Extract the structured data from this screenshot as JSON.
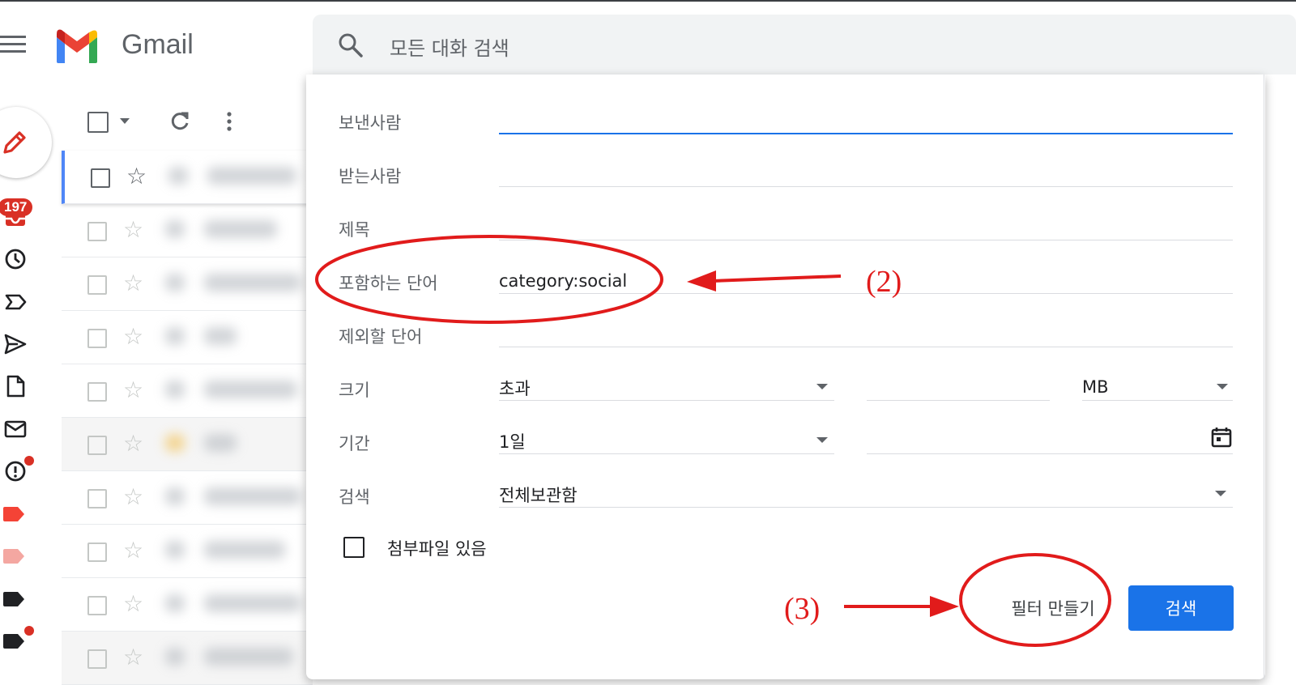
{
  "header": {
    "app_name": "Gmail",
    "search_placeholder": "모든 대화 검색"
  },
  "rail": {
    "inbox_badge": "197"
  },
  "search_panel": {
    "from_label": "보낸사람",
    "from_value": "",
    "to_label": "받는사람",
    "to_value": "",
    "subject_label": "제목",
    "subject_value": "",
    "has_words_label": "포함하는 단어",
    "has_words_value": "category:social",
    "doesnt_have_label": "제외할 단어",
    "doesnt_have_value": "",
    "size_label": "크기",
    "size_operator": "초과",
    "size_value": "",
    "size_unit": "MB",
    "date_label": "기간",
    "date_range": "1일",
    "date_value": "",
    "search_in_label": "검색",
    "search_in_value": "전체보관함",
    "has_attachment_label": "첨부파일 있음",
    "has_attachment_checked": false,
    "create_filter_label": "필터 만들기",
    "search_button_label": "검색"
  },
  "annotations": {
    "step2": "(2)",
    "step3": "(3)",
    "color": "#e11b1b"
  },
  "colors": {
    "accent": "#1a73e8",
    "badge": "#d93025"
  }
}
